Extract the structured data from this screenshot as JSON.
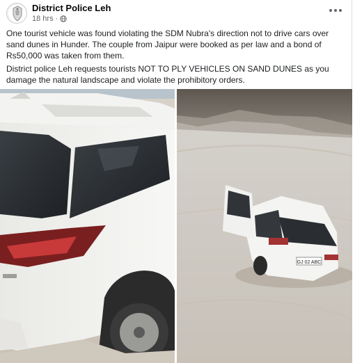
{
  "post": {
    "author": "District Police Leh",
    "time": "18 hrs",
    "privacy_icon": "globe-icon",
    "more_icon": "more-options-icon",
    "paragraph1": "One tourist vehicle was found violating the SDM Nubra's direction not to drive cars over sand dunes in Hunder. The couple from Jaipur were booked as per law and a bond of Rs50,000 was taken from them.",
    "paragraph2": "District police Leh requests tourists NOT TO PLY VEHICLES ON SAND DUNES as you damage the natural landscape and violate the prohibitory orders."
  },
  "photos": {
    "left": {
      "kind": "photo",
      "subject": "white SUV rear close-up stuck in sand"
    },
    "right": {
      "kind": "photo",
      "subject": "white SUV with open door stuck on sand dune",
      "plate_text": "GJ 02 ABC"
    }
  }
}
